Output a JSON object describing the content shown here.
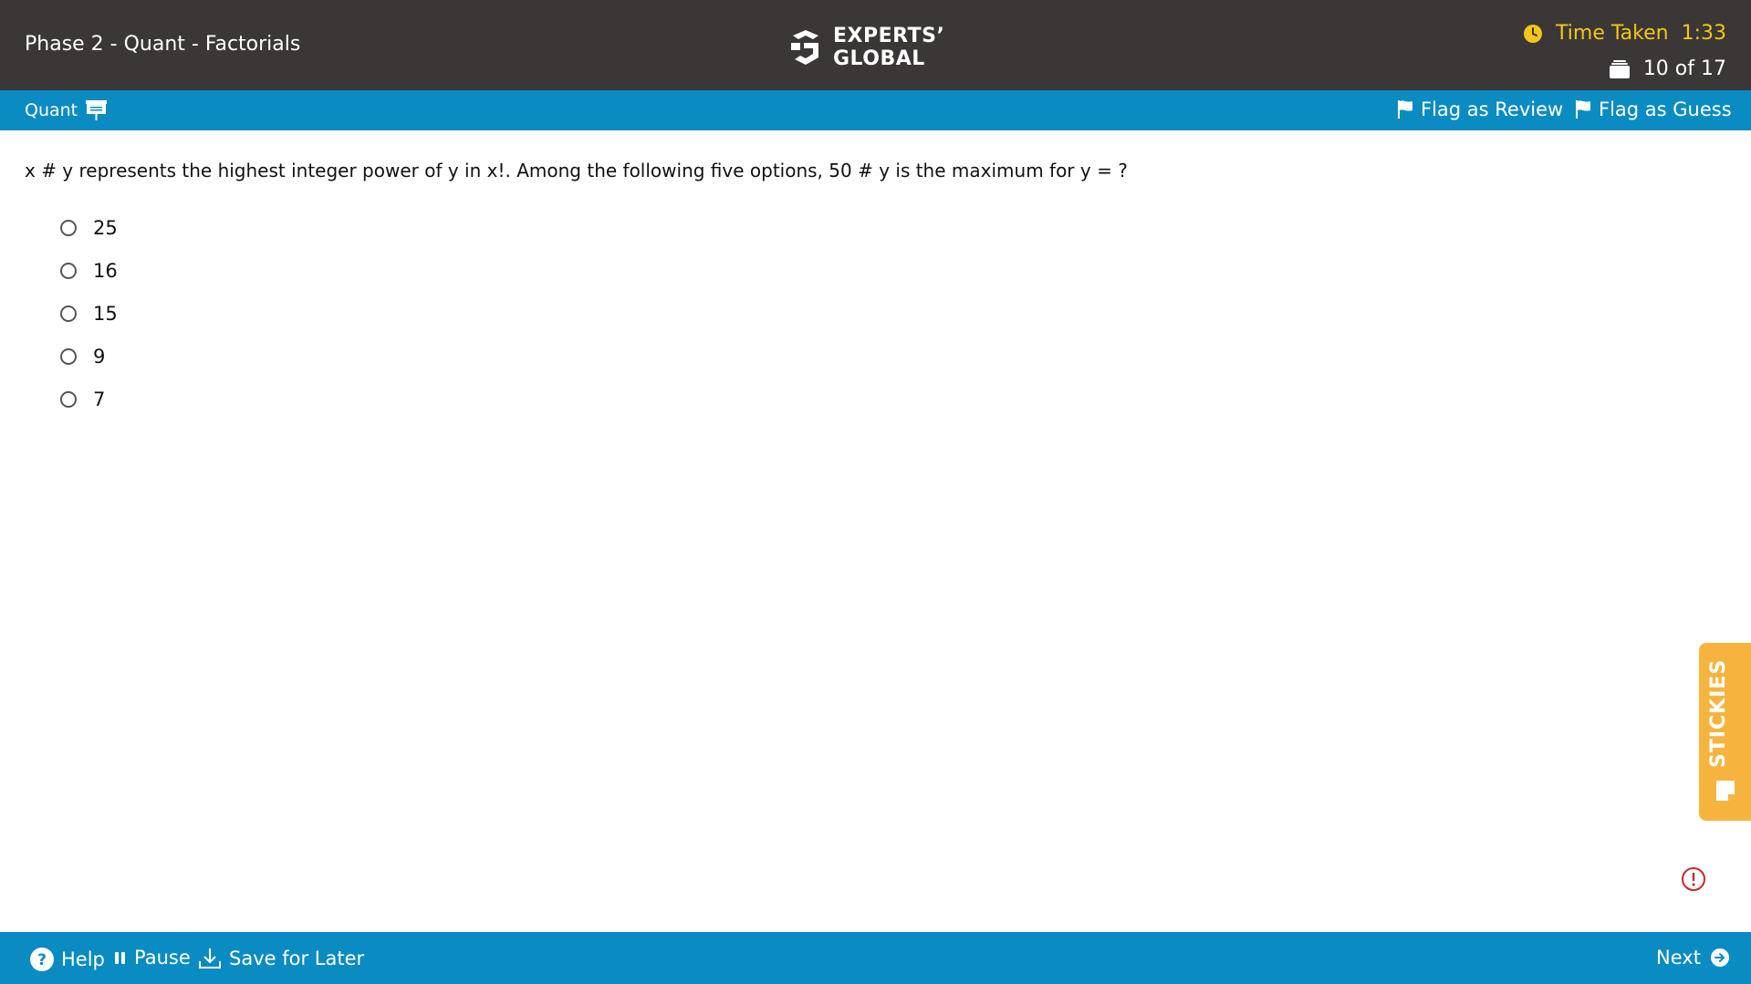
{
  "header": {
    "test_title": "Phase 2 - Quant - Factorials",
    "logo_line1": "EXPERTS’",
    "logo_line2": "GLOBAL",
    "timer_label": "Time Taken",
    "timer_value": "1:33",
    "progress": "10 of 17",
    "timer_color": "#f5c518"
  },
  "section_bar": {
    "section": "Quant",
    "flag_review": "Flag as Review",
    "flag_guess": "Flag as Guess"
  },
  "question": {
    "text": "x # y represents the highest integer power of y in x!. Among the following five options, 50 # y is the maximum for y = ?",
    "options": [
      "25",
      "16",
      "15",
      "9",
      "7"
    ]
  },
  "stickies": {
    "label": "STICKIES"
  },
  "footer": {
    "help": "Help",
    "pause": "Pause",
    "save": "Save for Later",
    "next": "Next"
  },
  "colors": {
    "header_bg": "#3a3736",
    "bar_blue": "#0a8bc2",
    "stickies_orange": "#f6b43f",
    "alert_red": "#c62828"
  }
}
